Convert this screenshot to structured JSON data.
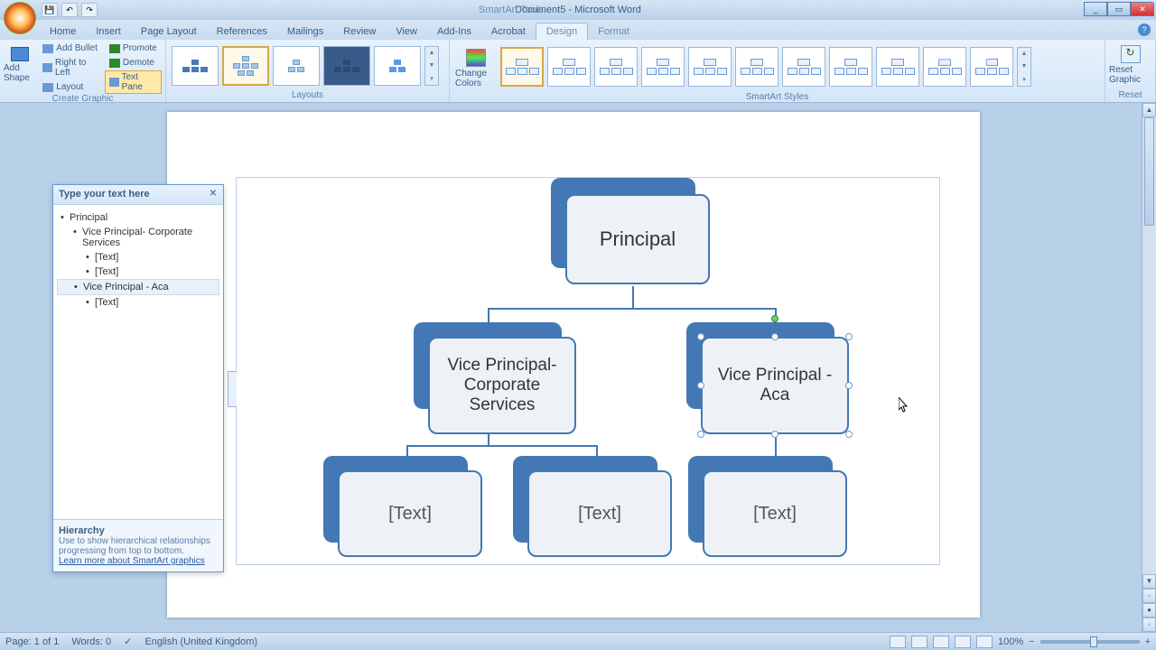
{
  "title": {
    "doc": "Document5 - Microsoft Word",
    "tools": "SmartArt Tools"
  },
  "qat": {
    "save": "💾",
    "undo": "↶",
    "redo": "↷"
  },
  "win": {
    "min": "_",
    "max": "▭",
    "close": "✕"
  },
  "tabs": {
    "home": "Home",
    "insert": "Insert",
    "page_layout": "Page Layout",
    "references": "References",
    "mailings": "Mailings",
    "review": "Review",
    "view": "View",
    "addins": "Add-Ins",
    "acrobat": "Acrobat",
    "design": "Design",
    "format": "Format",
    "help": "?"
  },
  "ribbon": {
    "add_shape": "Add Shape",
    "add_bullet": "Add Bullet",
    "rtl": "Right to Left",
    "layout": "Layout",
    "promote": "Promote",
    "demote": "Demote",
    "text_pane": "Text Pane",
    "group_create": "Create Graphic",
    "group_layouts": "Layouts",
    "change_colors": "Change Colors",
    "group_styles": "SmartArt Styles",
    "reset_graphic": "Reset Graphic",
    "group_reset": "Reset"
  },
  "text_pane": {
    "title": "Type your text here",
    "items": {
      "i0": "Principal",
      "i1": "Vice Principal- Corporate Services",
      "i2": "[Text]",
      "i3": "[Text]",
      "i4": "Vice Principal -  Aca",
      "i5": "[Text]"
    },
    "footer_title": "Hierarchy",
    "footer_desc": "Use to show hierarchical relationships progressing from top to bottom.",
    "footer_link": "Learn more about SmartArt graphics"
  },
  "smartart": {
    "n0": "Principal",
    "n1": "Vice Principal- Corporate Services",
    "n2": "Vice Principal -  Aca",
    "n3": "[Text]",
    "n4": "[Text]",
    "n5": "[Text]"
  },
  "status": {
    "page": "Page: 1 of 1",
    "words": "Words: 0",
    "lang": "English (United Kingdom)",
    "zoom": "100%",
    "minus": "−",
    "plus": "+"
  }
}
